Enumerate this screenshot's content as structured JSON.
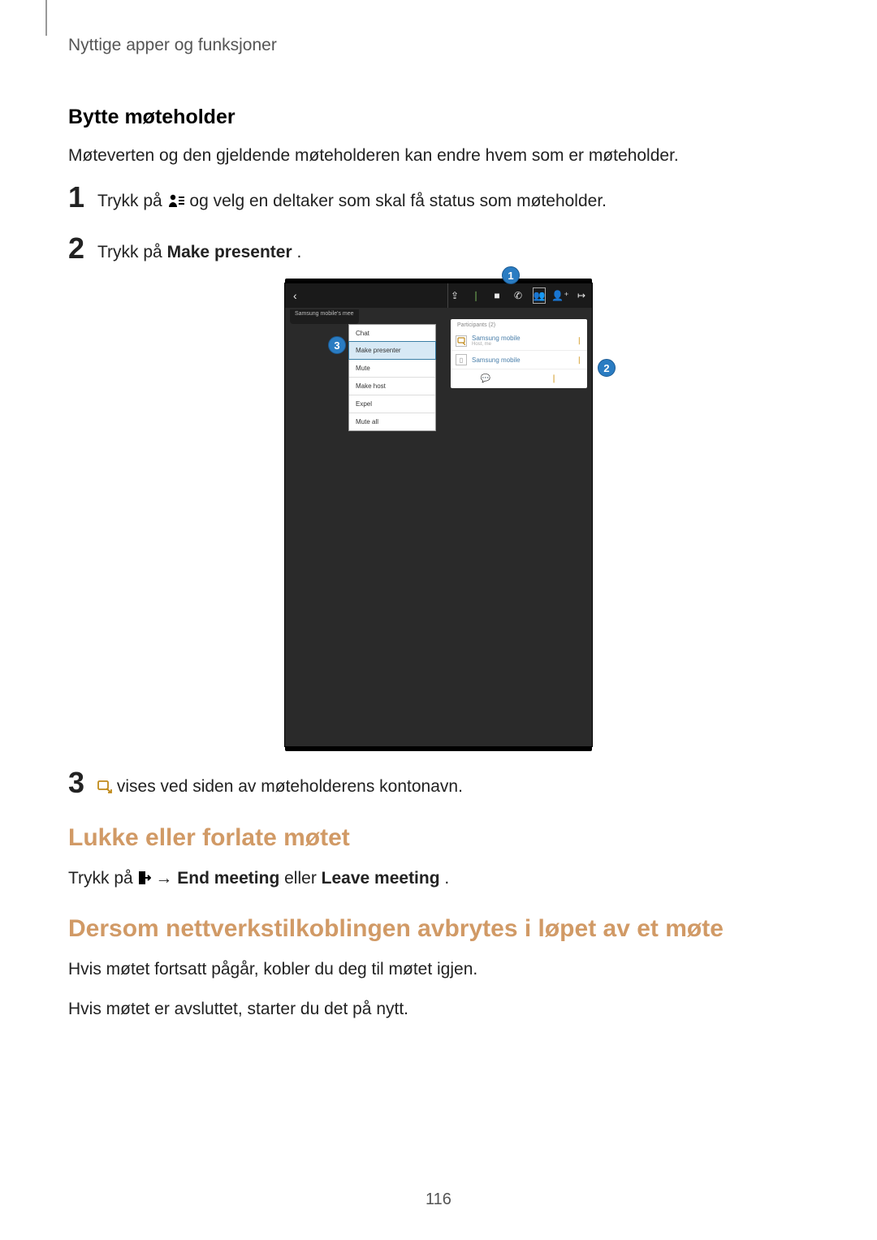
{
  "running_head": "Nyttige apper og funksjoner",
  "section1": {
    "title": "Bytte møteholder",
    "intro": "Møteverten og den gjeldende møteholderen kan endre hvem som er møteholder.",
    "step1_before": "Trykk på ",
    "step1_after": " og velg en deltaker som skal få status som møteholder.",
    "step2_before": "Trykk på ",
    "step2_bold": "Make presenter",
    "step2_after": ".",
    "step3": " vises ved siden av møteholderens kontonavn."
  },
  "figure": {
    "topbar": {
      "back": "‹",
      "share": "⇪",
      "mic": "❘",
      "video": "■",
      "phone": "✆",
      "participants": "👥",
      "addperson": "👤⁺",
      "exit": "↦"
    },
    "tab_label": "Samsung mobile's mee",
    "dropdown": [
      "Chat",
      "Make presenter",
      "Mute",
      "Make host",
      "Expel",
      "Mute all"
    ],
    "panel_head": "Participants (2)",
    "panel_rows": [
      {
        "name": "Samsung mobile",
        "sub": "Host, me"
      },
      {
        "name": "Samsung mobile",
        "sub": ""
      }
    ],
    "callouts": {
      "c1": "1",
      "c2": "2",
      "c3": "3"
    }
  },
  "section2": {
    "title": "Lukke eller forlate møtet",
    "line_before": "Trykk på ",
    "arrow": " → ",
    "bold1": "End meeting",
    "mid": " eller ",
    "bold2": "Leave meeting",
    "after": "."
  },
  "section3": {
    "title": "Dersom nettverkstilkoblingen avbrytes i løpet av et møte",
    "p1": "Hvis møtet fortsatt pågår, kobler du deg til møtet igjen.",
    "p2": "Hvis møtet er avsluttet, starter du det på nytt."
  },
  "page_number": "116"
}
